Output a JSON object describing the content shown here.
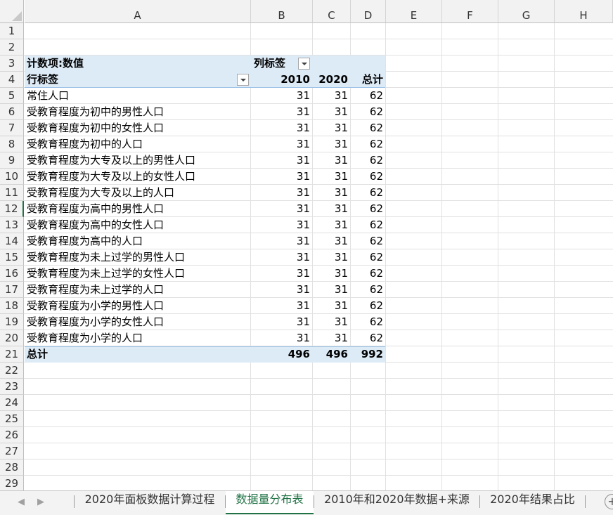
{
  "columns": [
    "A",
    "B",
    "C",
    "D",
    "E",
    "F",
    "G",
    "H"
  ],
  "rows": [
    "1",
    "2",
    "3",
    "4",
    "5",
    "6",
    "7",
    "8",
    "9",
    "10",
    "11",
    "12",
    "13",
    "14",
    "15",
    "16",
    "17",
    "18",
    "19",
    "20",
    "21",
    "22",
    "23",
    "24",
    "25",
    "26",
    "27",
    "28",
    "29"
  ],
  "pivot": {
    "value_field": "计数项:数值",
    "column_labels": "列标签",
    "row_labels": "行标签",
    "headers": [
      "2010",
      "2020",
      "总计"
    ],
    "items": [
      {
        "label": "常住人口",
        "v2010": "31",
        "v2020": "31",
        "total": "62"
      },
      {
        "label": "受教育程度为初中的男性人口",
        "v2010": "31",
        "v2020": "31",
        "total": "62"
      },
      {
        "label": "受教育程度为初中的女性人口",
        "v2010": "31",
        "v2020": "31",
        "total": "62"
      },
      {
        "label": "受教育程度为初中的人口",
        "v2010": "31",
        "v2020": "31",
        "total": "62"
      },
      {
        "label": "受教育程度为大专及以上的男性人口",
        "v2010": "31",
        "v2020": "31",
        "total": "62"
      },
      {
        "label": "受教育程度为大专及以上的女性人口",
        "v2010": "31",
        "v2020": "31",
        "total": "62"
      },
      {
        "label": "受教育程度为大专及以上的人口",
        "v2010": "31",
        "v2020": "31",
        "total": "62"
      },
      {
        "label": "受教育程度为高中的男性人口",
        "v2010": "31",
        "v2020": "31",
        "total": "62"
      },
      {
        "label": "受教育程度为高中的女性人口",
        "v2010": "31",
        "v2020": "31",
        "total": "62"
      },
      {
        "label": "受教育程度为高中的人口",
        "v2010": "31",
        "v2020": "31",
        "total": "62"
      },
      {
        "label": "受教育程度为未上过学的男性人口",
        "v2010": "31",
        "v2020": "31",
        "total": "62"
      },
      {
        "label": "受教育程度为未上过学的女性人口",
        "v2010": "31",
        "v2020": "31",
        "total": "62"
      },
      {
        "label": "受教育程度为未上过学的人口",
        "v2010": "31",
        "v2020": "31",
        "total": "62"
      },
      {
        "label": "受教育程度为小学的男性人口",
        "v2010": "31",
        "v2020": "31",
        "total": "62"
      },
      {
        "label": "受教育程度为小学的女性人口",
        "v2010": "31",
        "v2020": "31",
        "total": "62"
      },
      {
        "label": "受教育程度为小学的人口",
        "v2010": "31",
        "v2020": "31",
        "total": "62"
      }
    ],
    "grand_total": {
      "label": "总计",
      "v2010": "496",
      "v2020": "496",
      "total": "992"
    }
  },
  "tabs": [
    {
      "label": "2020年面板数据计算过程",
      "active": false
    },
    {
      "label": "数据量分布表",
      "active": true
    },
    {
      "label": "2010年和2020年数据+来源",
      "active": false
    },
    {
      "label": "2020年结果占比",
      "active": false
    }
  ],
  "nav": {
    "prev": "◀",
    "next": "▶",
    "add": "+"
  },
  "colors": {
    "pivot_band": "#ddebf7",
    "active_tab": "#217346"
  }
}
